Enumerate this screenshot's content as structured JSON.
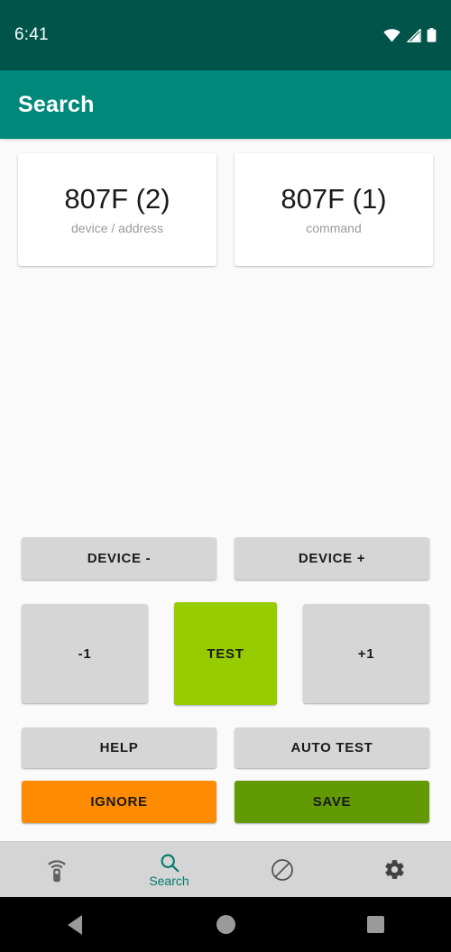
{
  "status_bar": {
    "clock": "6:41",
    "icons": [
      "wifi-icon",
      "cellular-signal-icon",
      "battery-icon"
    ],
    "background": "#00544A"
  },
  "app_bar": {
    "title": "Search",
    "background": "#00897B",
    "text_color": "#FFFFFF"
  },
  "cards": [
    {
      "value": "807F (2)",
      "label": "device / address"
    },
    {
      "value": "807F (1)",
      "label": "command"
    }
  ],
  "buttons": {
    "device_minus": "DEVICE -",
    "device_plus": "DEVICE +",
    "minus_one": "-1",
    "test": "TEST",
    "plus_one": "+1",
    "help": "HELP",
    "auto_test": "AUTO TEST",
    "ignore": "IGNORE",
    "save": "SAVE"
  },
  "colors": {
    "default_button": "#D6D6D6",
    "test_green": "#97CC00",
    "ignore_orange": "#FF8C00",
    "save_green": "#629A05",
    "accent_teal": "#00796B",
    "page_background": "#FAFAFA",
    "nav_background": "#D5D5D5"
  },
  "bottom_nav": {
    "items": [
      {
        "icon": "remote-control-icon",
        "label": "",
        "active": false
      },
      {
        "icon": "search-icon",
        "label": "Search",
        "active": true
      },
      {
        "icon": "block-icon",
        "label": "",
        "active": false
      },
      {
        "icon": "gear-icon",
        "label": "",
        "active": false
      }
    ]
  },
  "system_nav": {
    "back": "back-button",
    "home": "home-button",
    "recents": "recents-button"
  }
}
